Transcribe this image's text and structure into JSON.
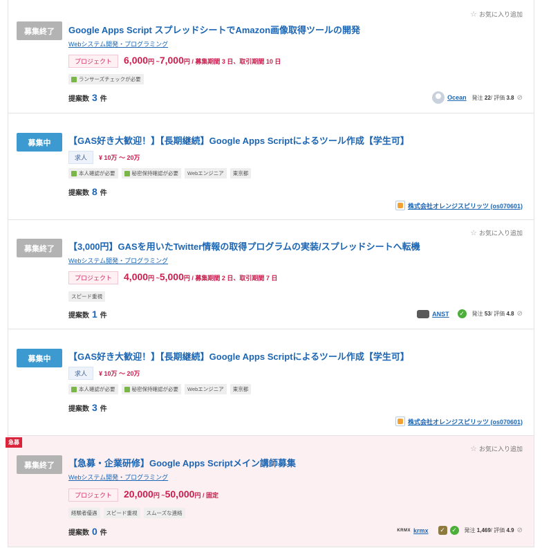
{
  "favorite_label": "お気に入り追加",
  "proposals_label": "提案数",
  "count_unit": "件",
  "cards": [
    {
      "status": "募集終了",
      "title": "Google Apps Script スプレッドシートでAmazon画像取得ツールの開発",
      "category": "Webシステム開発・プログラミング",
      "price_type": "プロジェクト",
      "price_low": "6,000",
      "price_sep": "円 ~",
      "price_high": "7,000",
      "price_suffix": "円 / 募集期間 3 日、取引期間 10 日",
      "tags": [
        "ランサーズチェックが必要"
      ],
      "proposals": "3",
      "client_name": "Ocean",
      "client_stats_order_label": "発注",
      "client_orders": "22",
      "client_rating_label": "/ 評価",
      "client_rating": "3.8"
    },
    {
      "status": "募集中",
      "title": "【GAS好き大歓迎！】【長期継続】Google Apps Scriptによるツール作成【学生可】",
      "price_type": "求人",
      "price_text": "¥ 10万 〜 20万",
      "tags": [
        "本人確認が必要",
        "秘密保持確認が必要",
        "Webエンジニア",
        "東京都"
      ],
      "proposals": "8",
      "client_name": "株式会社オレンジスピリッツ (os070601)"
    },
    {
      "status": "募集終了",
      "title": "【3,000円】GASを用いたTwitter情報の取得プログラムの実装/スプレッドシートへ転機",
      "category": "Webシステム開発・プログラミング",
      "price_type": "プロジェクト",
      "price_low": "4,000",
      "price_sep": "円 ~",
      "price_high": "5,000",
      "price_suffix": "円 / 募集期間 2 日、取引期間 7 日",
      "tags": [
        "スピード重視"
      ],
      "proposals": "1",
      "client_name": "ANST",
      "client_stats_order_label": "発注",
      "client_orders": "53",
      "client_rating_label": "/ 評価",
      "client_rating": "4.8"
    },
    {
      "status": "募集中",
      "title": "【GAS好き大歓迎！】【長期継続】Google Apps Scriptによるツール作成【学生可】",
      "price_type": "求人",
      "price_text": "¥ 10万 〜 20万",
      "tags": [
        "本人確認が必要",
        "秘密保持確認が必要",
        "Webエンジニア",
        "東京都"
      ],
      "proposals": "3",
      "client_name": "株式会社オレンジスピリッツ (os070601)"
    },
    {
      "urgent": "急募",
      "status": "募集終了",
      "title": "【急募・企業研修】Google Apps Scriptメイン講師募集",
      "category": "Webシステム開発・プログラミング",
      "price_type": "プロジェクト",
      "price_low": "20,000",
      "price_sep": "円 ~",
      "price_high": "50,000",
      "price_suffix": "円 / 固定",
      "tags": [
        "経験者優遇",
        "スピード重視",
        "スムーズな連絡"
      ],
      "proposals": "0",
      "client_logo_text": "KRMX",
      "client_name": "krmx",
      "client_stats_order_label": "発注",
      "client_orders": "1,469",
      "client_rating_label": "/ 評価",
      "client_rating": "4.9"
    }
  ]
}
